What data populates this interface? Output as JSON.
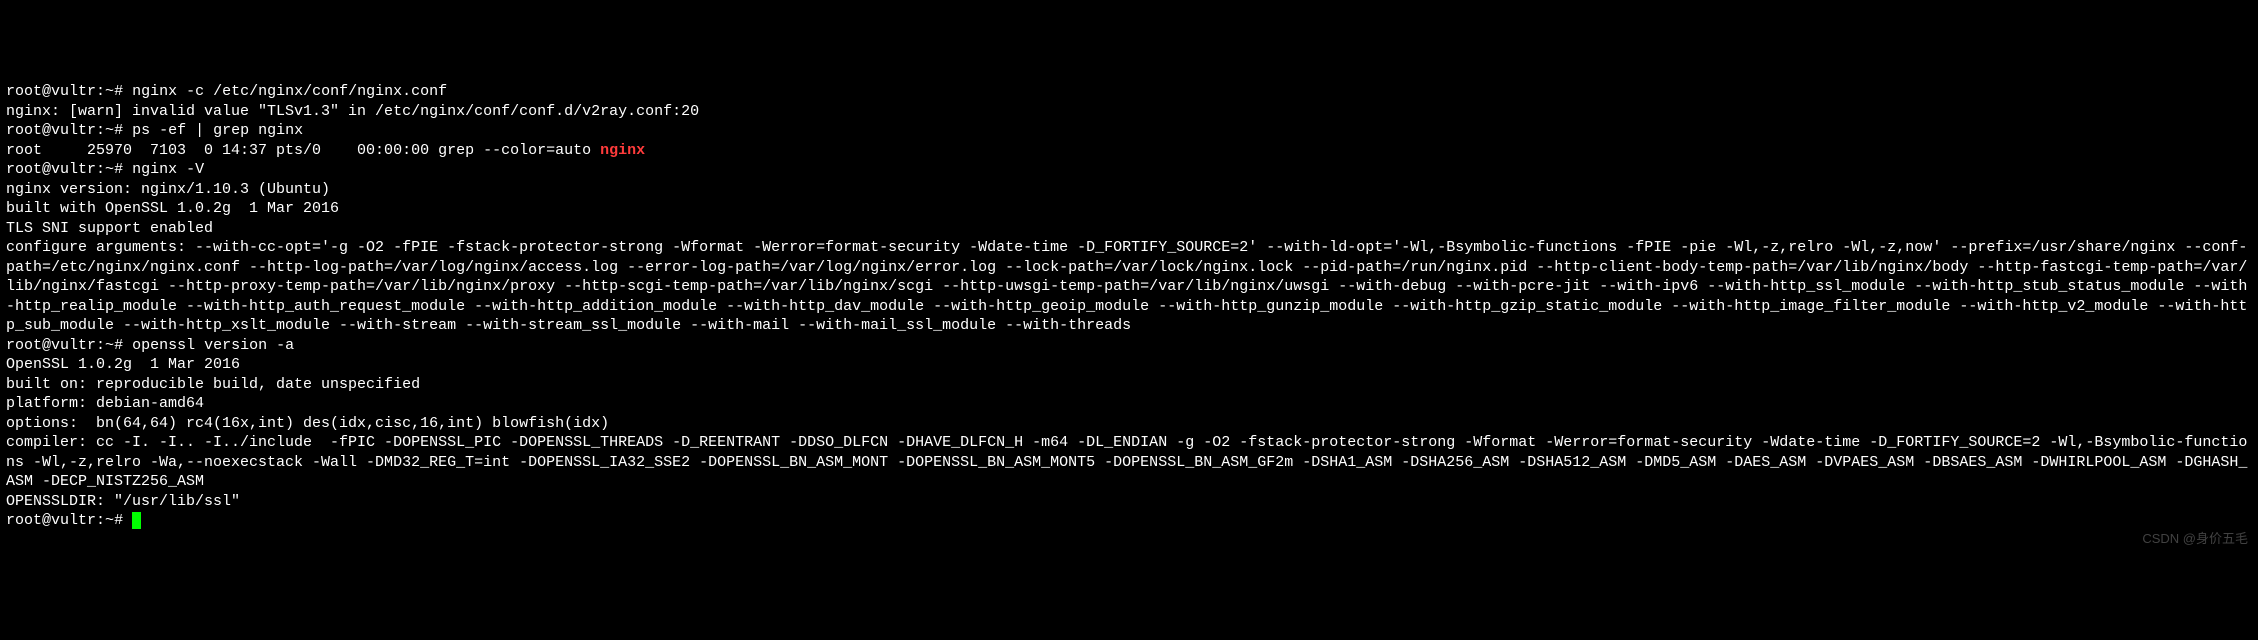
{
  "watermark": "CSDN @身价五毛",
  "lines": {
    "0": {
      "user": "root",
      "at": "@",
      "host": "vultr",
      "path": ":~",
      "hash": "#",
      "cmd": "nginx -c /etc/nginx/conf/nginx.conf"
    },
    "1": {
      "text": "nginx: [warn] invalid value \"TLSv1.3\" in /etc/nginx/conf/conf.d/v2ray.conf:20"
    },
    "2": {
      "user": "root",
      "at": "@",
      "host": "vultr",
      "path": ":~",
      "hash": "#",
      "cmd": "ps -ef | grep nginx"
    },
    "3": {
      "pre": "root     25970  7103  0 14:37 pts/0    00:00:00 grep --color=auto ",
      "match": "nginx"
    },
    "4": {
      "user": "root",
      "at": "@",
      "host": "vultr",
      "path": ":~",
      "hash": "#",
      "cmd": "nginx -V"
    },
    "5": {
      "text": "nginx version: nginx/1.10.3 (Ubuntu)"
    },
    "6": {
      "text": "built with OpenSSL 1.0.2g  1 Mar 2016"
    },
    "7": {
      "text": "TLS SNI support enabled"
    },
    "8": {
      "text": "configure arguments: --with-cc-opt='-g -O2 -fPIE -fstack-protector-strong -Wformat -Werror=format-security -Wdate-time -D_FORTIFY_SOURCE=2' --with-ld-opt='-Wl,-Bsymbolic-functions -fPIE -pie -Wl,-z,relro -Wl,-z,now' --prefix=/usr/share/nginx --conf-path=/etc/nginx/nginx.conf --http-log-path=/var/log/nginx/access.log --error-log-path=/var/log/nginx/error.log --lock-path=/var/lock/nginx.lock --pid-path=/run/nginx.pid --http-client-body-temp-path=/var/lib/nginx/body --http-fastcgi-temp-path=/var/lib/nginx/fastcgi --http-proxy-temp-path=/var/lib/nginx/proxy --http-scgi-temp-path=/var/lib/nginx/scgi --http-uwsgi-temp-path=/var/lib/nginx/uwsgi --with-debug --with-pcre-jit --with-ipv6 --with-http_ssl_module --with-http_stub_status_module --with-http_realip_module --with-http_auth_request_module --with-http_addition_module --with-http_dav_module --with-http_geoip_module --with-http_gunzip_module --with-http_gzip_static_module --with-http_image_filter_module --with-http_v2_module --with-http_sub_module --with-http_xslt_module --with-stream --with-stream_ssl_module --with-mail --with-mail_ssl_module --with-threads"
    },
    "9": {
      "user": "root",
      "at": "@",
      "host": "vultr",
      "path": ":~",
      "hash": "#",
      "cmd": "openssl version -a"
    },
    "10": {
      "text": "OpenSSL 1.0.2g  1 Mar 2016"
    },
    "11": {
      "text": "built on: reproducible build, date unspecified"
    },
    "12": {
      "text": "platform: debian-amd64"
    },
    "13": {
      "text": "options:  bn(64,64) rc4(16x,int) des(idx,cisc,16,int) blowfish(idx)"
    },
    "14": {
      "text": "compiler: cc -I. -I.. -I../include  -fPIC -DOPENSSL_PIC -DOPENSSL_THREADS -D_REENTRANT -DDSO_DLFCN -DHAVE_DLFCN_H -m64 -DL_ENDIAN -g -O2 -fstack-protector-strong -Wformat -Werror=format-security -Wdate-time -D_FORTIFY_SOURCE=2 -Wl,-Bsymbolic-functions -Wl,-z,relro -Wa,--noexecstack -Wall -DMD32_REG_T=int -DOPENSSL_IA32_SSE2 -DOPENSSL_BN_ASM_MONT -DOPENSSL_BN_ASM_MONT5 -DOPENSSL_BN_ASM_GF2m -DSHA1_ASM -DSHA256_ASM -DSHA512_ASM -DMD5_ASM -DAES_ASM -DVPAES_ASM -DBSAES_ASM -DWHIRLPOOL_ASM -DGHASH_ASM -DECP_NISTZ256_ASM"
    },
    "15": {
      "text": "OPENSSLDIR: \"/usr/lib/ssl\""
    },
    "16": {
      "user": "root",
      "at": "@",
      "host": "vultr",
      "path": ":~",
      "hash": "#"
    }
  }
}
